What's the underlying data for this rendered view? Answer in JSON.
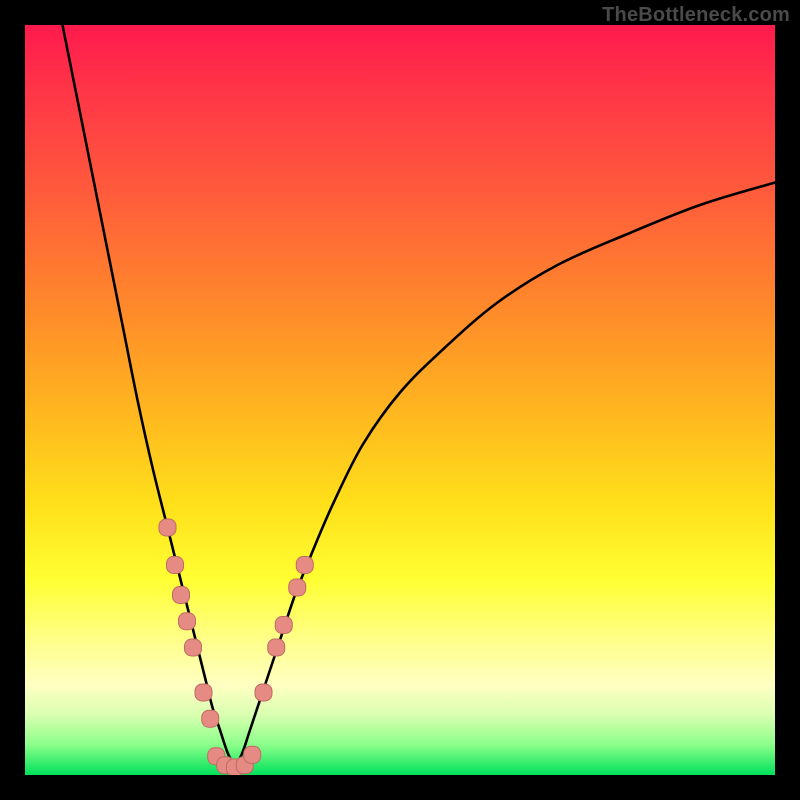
{
  "watermark": {
    "text": "TheBottleneck.com"
  },
  "colors": {
    "background": "#000000",
    "curve": "#000000",
    "marker_fill": "#e58b84",
    "marker_stroke": "#bf6a63"
  },
  "chart_data": {
    "type": "line",
    "title": "",
    "xlabel": "",
    "ylabel": "",
    "xlim": [
      0,
      100
    ],
    "ylim": [
      0,
      100
    ],
    "grid": false,
    "legend": false,
    "series": [
      {
        "name": "left-curve",
        "x": [
          5,
          7,
          9,
          11,
          13,
          15,
          17,
          19,
          20,
          21,
          22,
          23,
          24,
          25,
          26,
          27,
          28
        ],
        "y": [
          100,
          90,
          80,
          70,
          60,
          50,
          41,
          33,
          29,
          25,
          21,
          17,
          13,
          9,
          6,
          3,
          1
        ]
      },
      {
        "name": "right-curve",
        "x": [
          28,
          29,
          30,
          32,
          34,
          36,
          38,
          41,
          45,
          50,
          56,
          63,
          71,
          80,
          90,
          100
        ],
        "y": [
          1,
          3,
          6,
          12,
          18,
          24,
          29,
          36,
          44,
          51,
          57,
          63,
          68,
          72,
          76,
          79
        ]
      },
      {
        "name": "markers-left",
        "x": [
          19.0,
          20.0,
          20.8,
          21.6,
          22.4,
          23.8,
          24.7
        ],
        "y": [
          33.0,
          28.0,
          24.0,
          20.5,
          17.0,
          11.0,
          7.5
        ]
      },
      {
        "name": "markers-right",
        "x": [
          31.8,
          33.5,
          34.5,
          36.3,
          37.3
        ],
        "y": [
          11.0,
          17.0,
          20.0,
          25.0,
          28.0
        ]
      },
      {
        "name": "markers-bottom",
        "x": [
          25.5,
          26.7,
          28.0,
          29.3,
          30.3
        ],
        "y": [
          2.5,
          1.3,
          1.0,
          1.3,
          2.7
        ]
      }
    ]
  }
}
